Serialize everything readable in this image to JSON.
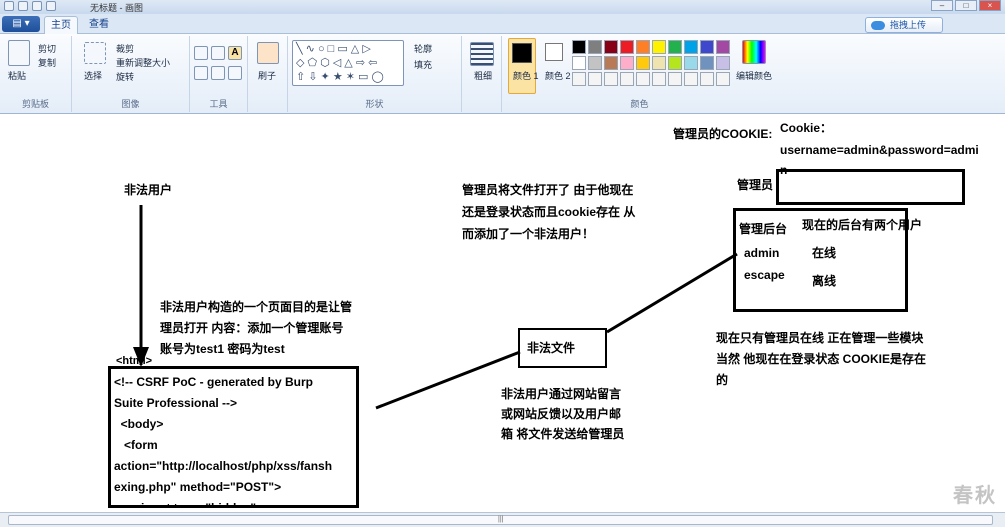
{
  "window": {
    "title": "无标题 - 画图"
  },
  "tabs": {
    "file": "▤ ▾",
    "home": "主页",
    "view": "查看"
  },
  "upload": {
    "label": "拖拽上传"
  },
  "ribbon": {
    "clipboard": {
      "paste": "粘贴",
      "cut": "剪切",
      "copy": "复制",
      "label": "剪贴板"
    },
    "image": {
      "select": "选择",
      "crop": "裁剪",
      "resize": "重新调整大小",
      "rotate": "旋转",
      "label": "图像"
    },
    "tools": {
      "label": "工具",
      "text": "A"
    },
    "brushes": {
      "label": "刷子"
    },
    "shapes": {
      "outline": "轮廓",
      "fill": "填充",
      "label": "形状"
    },
    "size": {
      "label": "粗细"
    },
    "colors": {
      "color1": "颜色 1",
      "color2": "颜色 2",
      "edit": "编辑颜色",
      "label": "颜色",
      "palette": [
        "#000000",
        "#7f7f7f",
        "#880015",
        "#ed1c24",
        "#ff7f27",
        "#fff200",
        "#22b14c",
        "#00a2e8",
        "#3f48cc",
        "#a349a4",
        "#ffffff",
        "#c3c3c3",
        "#b97a57",
        "#ffaec9",
        "#ffc90e",
        "#efe4b0",
        "#b5e61d",
        "#99d9ea",
        "#7092be",
        "#c8bfe7"
      ]
    }
  },
  "canvas": {
    "illegal_user": "非法用户",
    "attacker_desc": [
      "非法用户构造的一个页面目的是让管",
      "理员打开   内容：添加一个管理账号",
      "账号为test1 密码为test"
    ],
    "html_tag": "<html>",
    "code": [
      "<!-- CSRF PoC - generated by Burp",
      "Suite Professional -->",
      "  <body>",
      "   <form",
      "action=\"http://localhost/php/xss/fansh",
      "exing.php\" method=\"POST\">",
      "      <input type=\"hidden\""
    ],
    "illegal_file": "非法文件",
    "file_desc": [
      "非法用户通过网站留言",
      "或网站反馈以及用户邮",
      "箱 将文件发送给管理员"
    ],
    "admin_opened": [
      "管理员将文件打开了 由于他现在",
      "还是登录状态而且cookie存在 从",
      "而添加了一个非法用户！"
    ],
    "cookie_label": "管理员的COOKIE:",
    "cookie_value": [
      "Cookie：",
      "username=admin&password=admi",
      "n"
    ],
    "admin_label": "管理员",
    "backend": {
      "title": "管理后台",
      "note": "现在的后台有两个用户",
      "users": [
        {
          "name": "admin",
          "status": "在线"
        },
        {
          "name": "escape",
          "status": "离线"
        }
      ]
    },
    "admin_online": [
      "现在只有管理员在线 正在管理一些模块",
      "当然 他现在在登录状态 COOKIE是存在",
      "的"
    ],
    "watermark": "春秋"
  },
  "scroll": {
    "grip": "|||"
  }
}
